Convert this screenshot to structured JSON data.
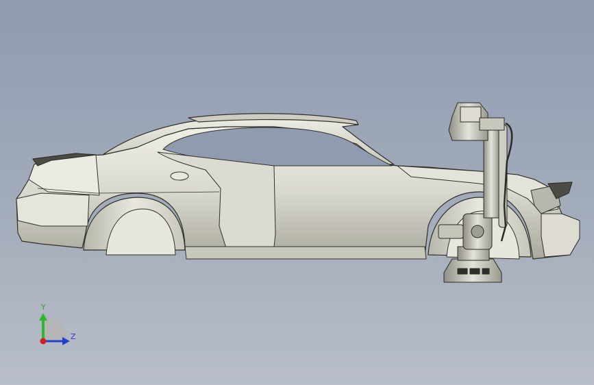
{
  "viewport": {
    "background_top": "#8e9bb0",
    "background_bottom": "#b9bec8"
  },
  "model": {
    "body_color": "#d6d5cb",
    "edge_color": "#2f2f2a"
  },
  "triad": {
    "y_label": "Y",
    "z_label": "Z",
    "y_color": "#2fb52f",
    "z_color": "#2040d0",
    "x_color": "#d02020"
  }
}
